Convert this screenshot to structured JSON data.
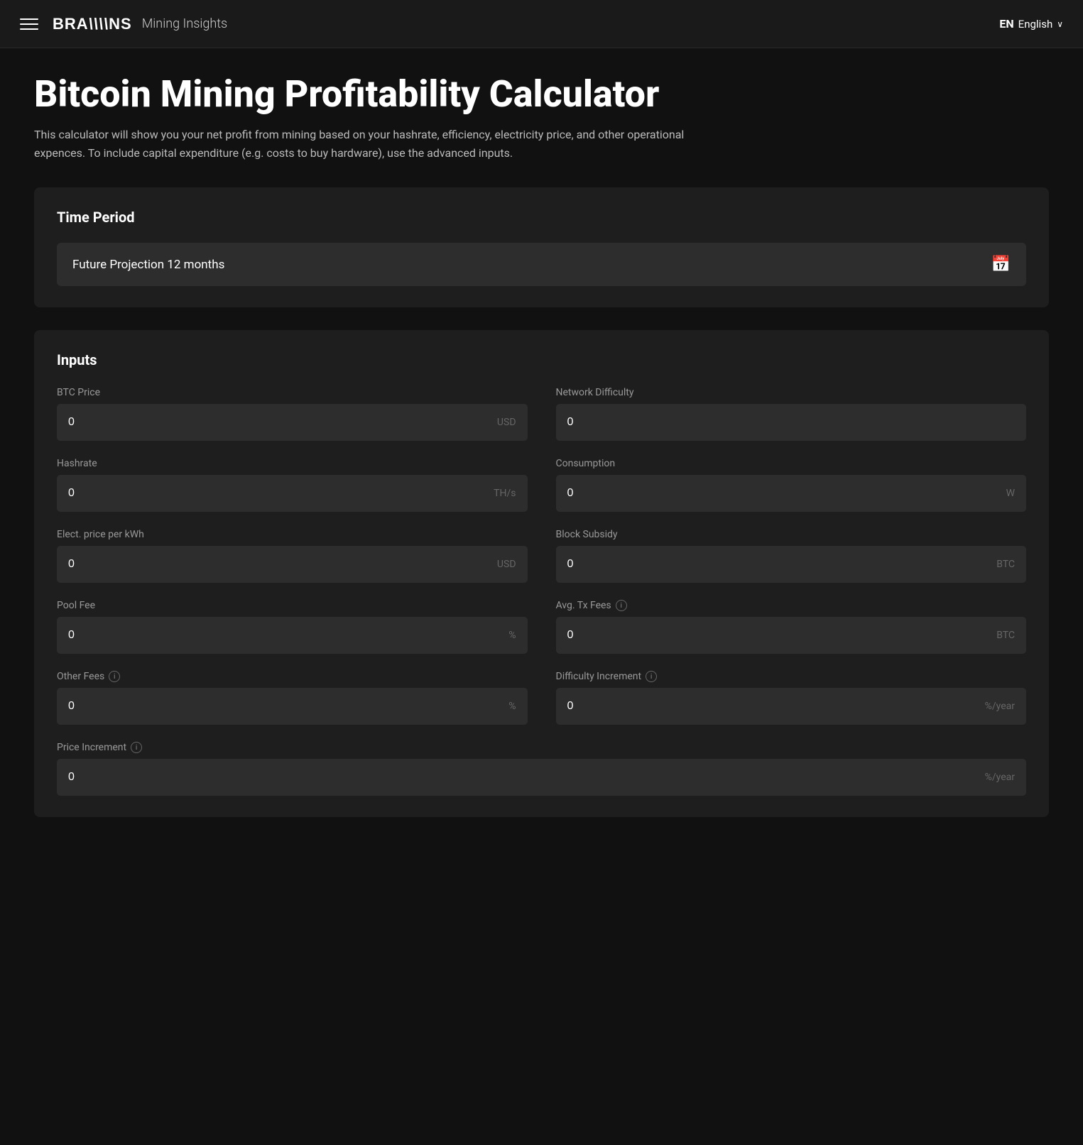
{
  "navbar": {
    "brand_logo": "BRA\\\\NS",
    "brand_subtitle": "Mining Insights",
    "lang_code": "EN",
    "lang_label": "English"
  },
  "page": {
    "title": "Bitcoin Mining Profitability Calculator",
    "description": "This calculator will show you your net profit from mining based on your hashrate, efficiency, electricity price, and other operational expences. To include capital expenditure (e.g. costs to buy hardware), use the advanced inputs."
  },
  "time_period": {
    "section_title": "Time Period",
    "selected_value": "Future Projection 12 months"
  },
  "inputs": {
    "section_title": "Inputs",
    "fields": [
      {
        "id": "btc-price",
        "label": "BTC Price",
        "value": "0",
        "unit": "USD",
        "has_info": false,
        "full_width": false
      },
      {
        "id": "network-difficulty",
        "label": "Network Difficulty",
        "value": "0",
        "unit": "",
        "has_info": false,
        "full_width": false
      },
      {
        "id": "hashrate",
        "label": "Hashrate",
        "value": "0",
        "unit": "TH/s",
        "has_info": false,
        "full_width": false
      },
      {
        "id": "consumption",
        "label": "Consumption",
        "value": "0",
        "unit": "W",
        "has_info": false,
        "full_width": false
      },
      {
        "id": "elec-price",
        "label": "Elect. price per kWh",
        "value": "0",
        "unit": "USD",
        "has_info": false,
        "full_width": false
      },
      {
        "id": "block-subsidy",
        "label": "Block Subsidy",
        "value": "0",
        "unit": "BTC",
        "has_info": false,
        "full_width": false
      },
      {
        "id": "pool-fee",
        "label": "Pool Fee",
        "value": "0",
        "unit": "%",
        "has_info": false,
        "full_width": false
      },
      {
        "id": "avg-tx-fees",
        "label": "Avg. Tx Fees",
        "value": "0",
        "unit": "BTC",
        "has_info": true,
        "full_width": false
      },
      {
        "id": "other-fees",
        "label": "Other Fees",
        "value": "0",
        "unit": "%",
        "has_info": true,
        "full_width": false
      },
      {
        "id": "difficulty-increment",
        "label": "Difficulty Increment",
        "value": "0",
        "unit": "%/year",
        "has_info": true,
        "full_width": false
      },
      {
        "id": "price-increment",
        "label": "Price Increment",
        "value": "0",
        "unit": "%/year",
        "has_info": true,
        "full_width": true
      }
    ]
  },
  "icons": {
    "hamburger": "☰",
    "calendar": "📅",
    "info": "i",
    "chevron_down": "∨"
  }
}
